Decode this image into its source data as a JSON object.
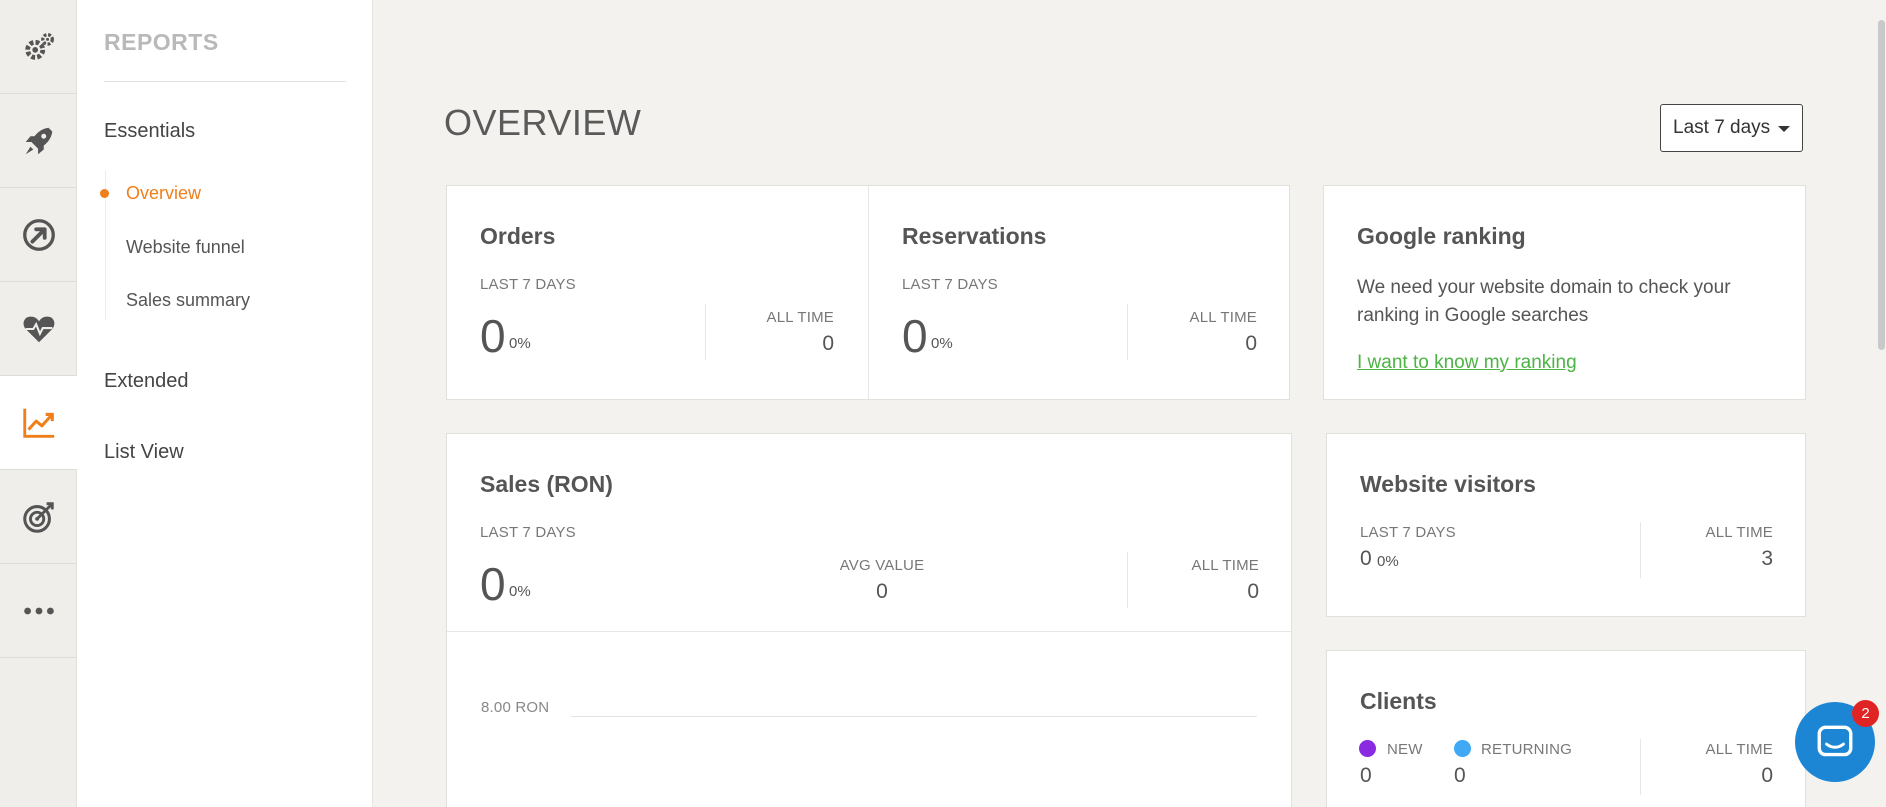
{
  "sidebar": {
    "title": "REPORTS",
    "groups": [
      {
        "label": "Essentials"
      },
      {
        "label": "Extended"
      },
      {
        "label": "List View"
      }
    ],
    "essentials_items": [
      {
        "label": "Overview",
        "active": true
      },
      {
        "label": "Website funnel"
      },
      {
        "label": "Sales summary"
      }
    ]
  },
  "rail": {
    "icons": [
      "gears-icon",
      "rocket-icon",
      "arrow-circle-icon",
      "heart-pulse-icon",
      "chart-line-icon",
      "target-icon",
      "more-dots-icon"
    ],
    "active_index": 4,
    "accent": "#f07e1a"
  },
  "main": {
    "title": "OVERVIEW",
    "range": "Last 7 days"
  },
  "orders": {
    "title": "Orders",
    "period_label": "LAST 7 DAYS",
    "value": "0",
    "pct": "0%",
    "alltime_label": "ALL TIME",
    "alltime_value": "0"
  },
  "reservations": {
    "title": "Reservations",
    "period_label": "LAST 7 DAYS",
    "value": "0",
    "pct": "0%",
    "alltime_label": "ALL TIME",
    "alltime_value": "0"
  },
  "google": {
    "title": "Google ranking",
    "text": "We need your website domain to check your ranking in Google searches",
    "link": "I want to know my ranking"
  },
  "sales": {
    "title": "Sales (RON)",
    "period_label": "LAST 7 DAYS",
    "value": "0",
    "pct": "0%",
    "avg_label": "AVG VALUE",
    "avg_value": "0",
    "alltime_label": "ALL TIME",
    "alltime_value": "0",
    "chart_tick": "8.00 RON"
  },
  "visitors": {
    "title": "Website visitors",
    "period_label": "LAST 7 DAYS",
    "value": "0",
    "pct": "0%",
    "alltime_label": "ALL TIME",
    "alltime_value": "3"
  },
  "clients": {
    "title": "Clients",
    "new_label": "NEW",
    "new_value": "0",
    "new_color": "#8a2be2",
    "returning_label": "RETURNING",
    "returning_value": "0",
    "returning_color": "#3fa9f5",
    "alltime_label": "ALL TIME",
    "alltime_value": "0"
  },
  "chat": {
    "badge": "2"
  }
}
